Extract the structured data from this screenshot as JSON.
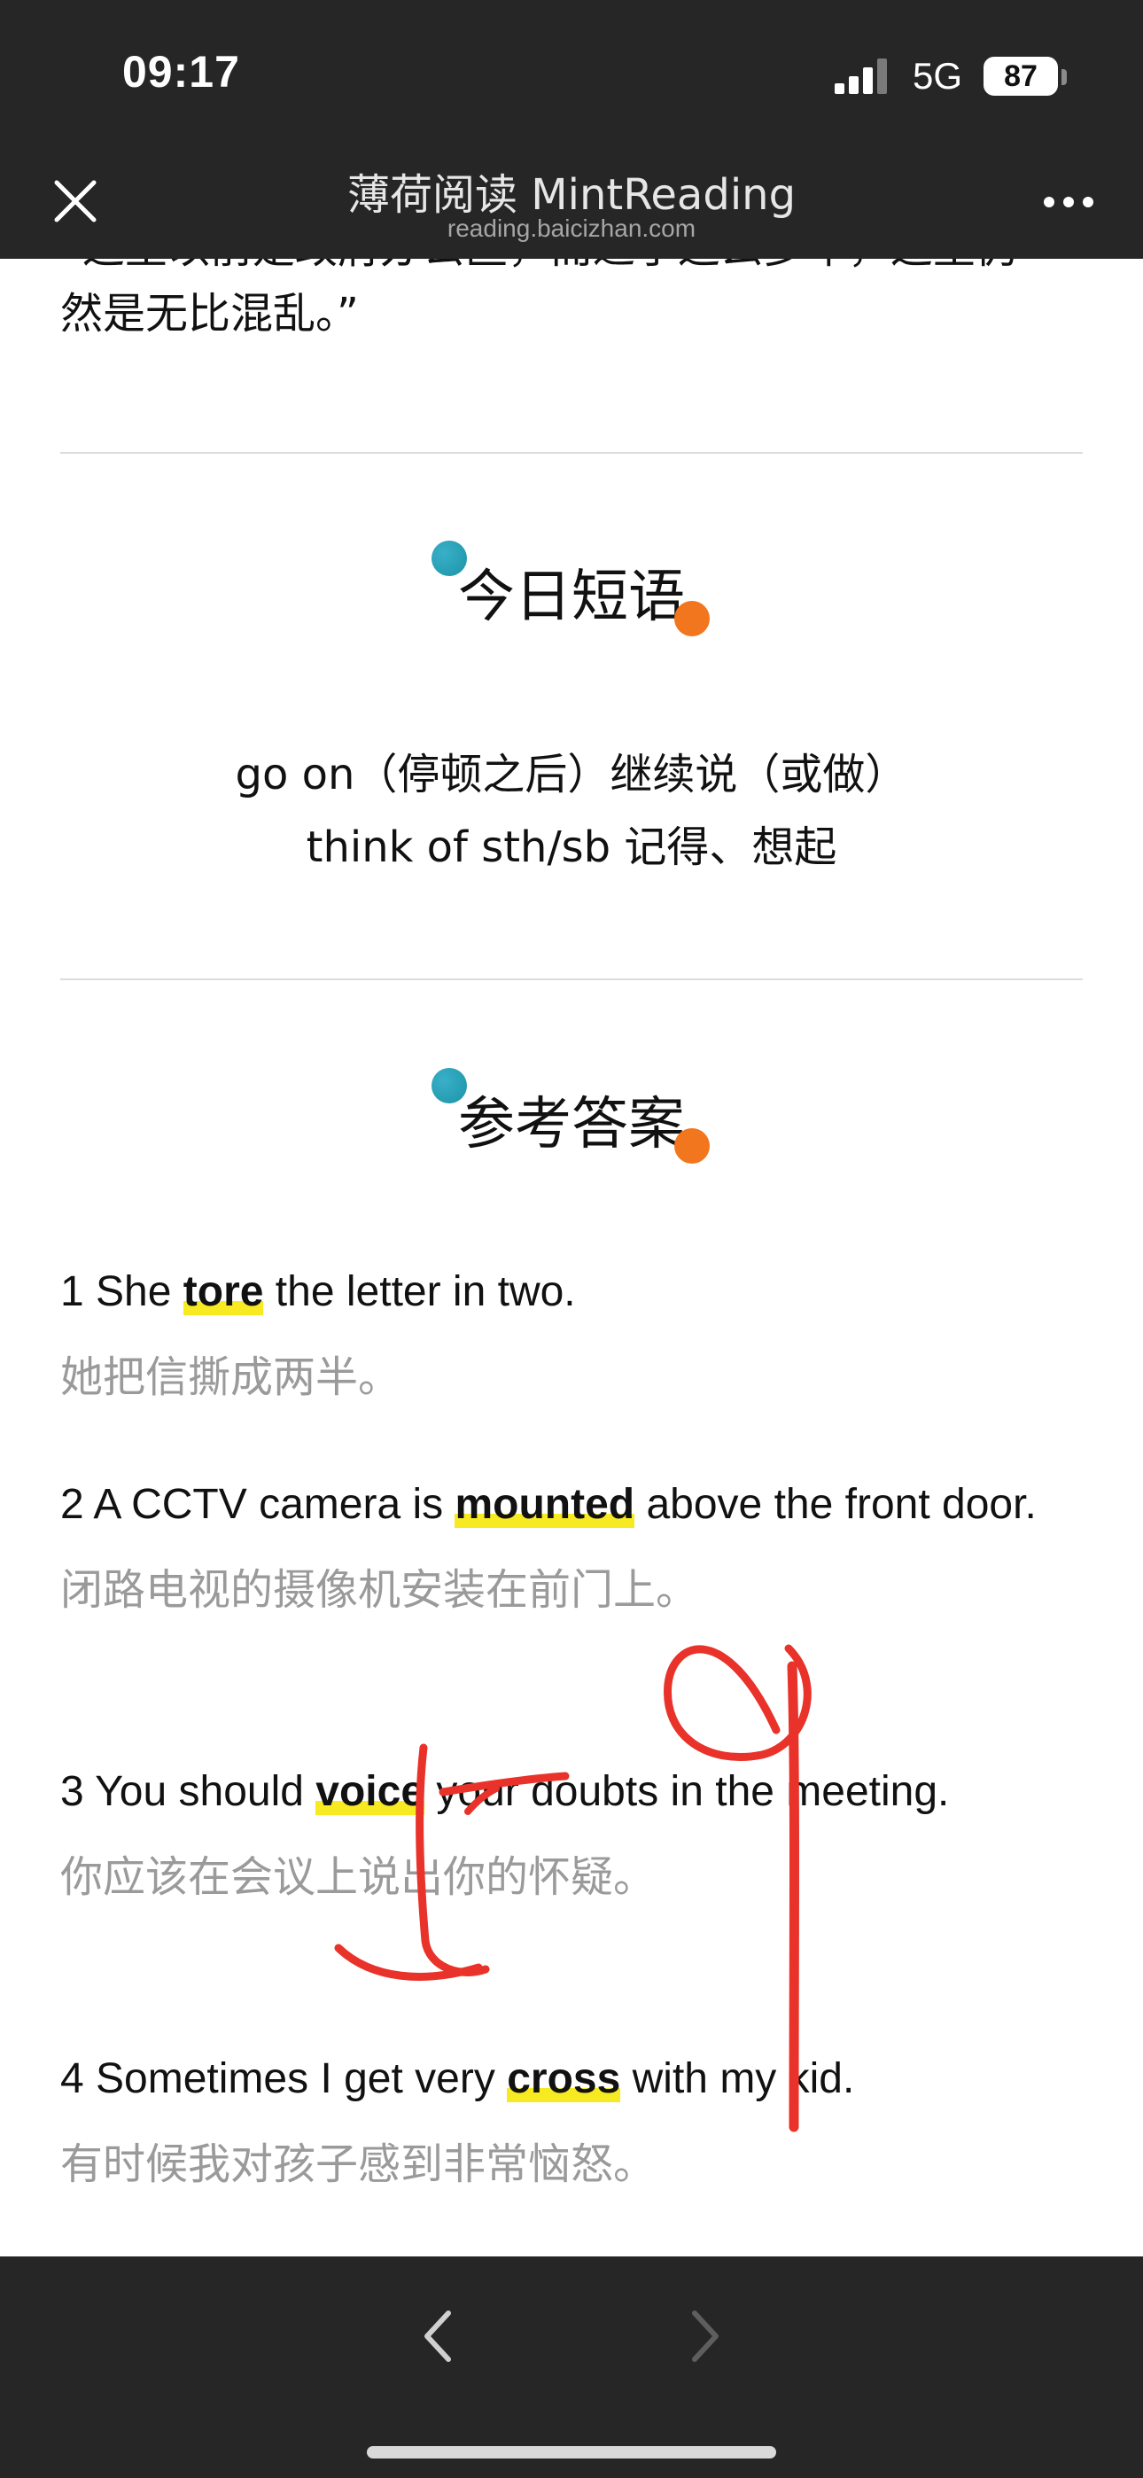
{
  "status_bar": {
    "time": "09:17",
    "network": "5G",
    "battery": "87"
  },
  "nav": {
    "title": "薄荷阅读 MintReading",
    "subtitle": "reading.baicizhan.com"
  },
  "article": {
    "partial_line": "“这里以前是政府办公区，而过了这么多年，这里仍",
    "quote_end": "然是无比混乱。”"
  },
  "phrases": {
    "heading": "今日短语",
    "items": [
      "go on（停顿之后）继续说（或做）",
      "think of sth/sb 记得、想起"
    ]
  },
  "answers": {
    "heading": "参考答案",
    "items": [
      {
        "pre": "1 She ",
        "word": "tore",
        "post": " the letter in two.",
        "zh": "她把信撕成两半。"
      },
      {
        "pre": "2 A CCTV camera is ",
        "word": "mounted",
        "post": " above the front door.",
        "zh": "闭路电视的摄像机安装在前门上。"
      },
      {
        "pre": "3 You should ",
        "word": "voice",
        "post": " your doubts in the meeting.",
        "zh": "你应该在会议上说出你的怀疑。"
      },
      {
        "pre": "4 Sometimes I get very ",
        "word": "cross",
        "post": " with my kid.",
        "zh": "有时候我对孩子感到非常恼怒。"
      }
    ]
  },
  "colors": {
    "bar_bg": "#262626",
    "highlight": "#f7ea22",
    "annotation": "#e8322a",
    "dot_teal": "#1c93a5",
    "dot_orange": "#f2761e"
  },
  "icons": [
    "signal-icon",
    "battery-icon",
    "close-icon",
    "more-icon",
    "back-arrow-icon",
    "forward-arrow-icon"
  ]
}
